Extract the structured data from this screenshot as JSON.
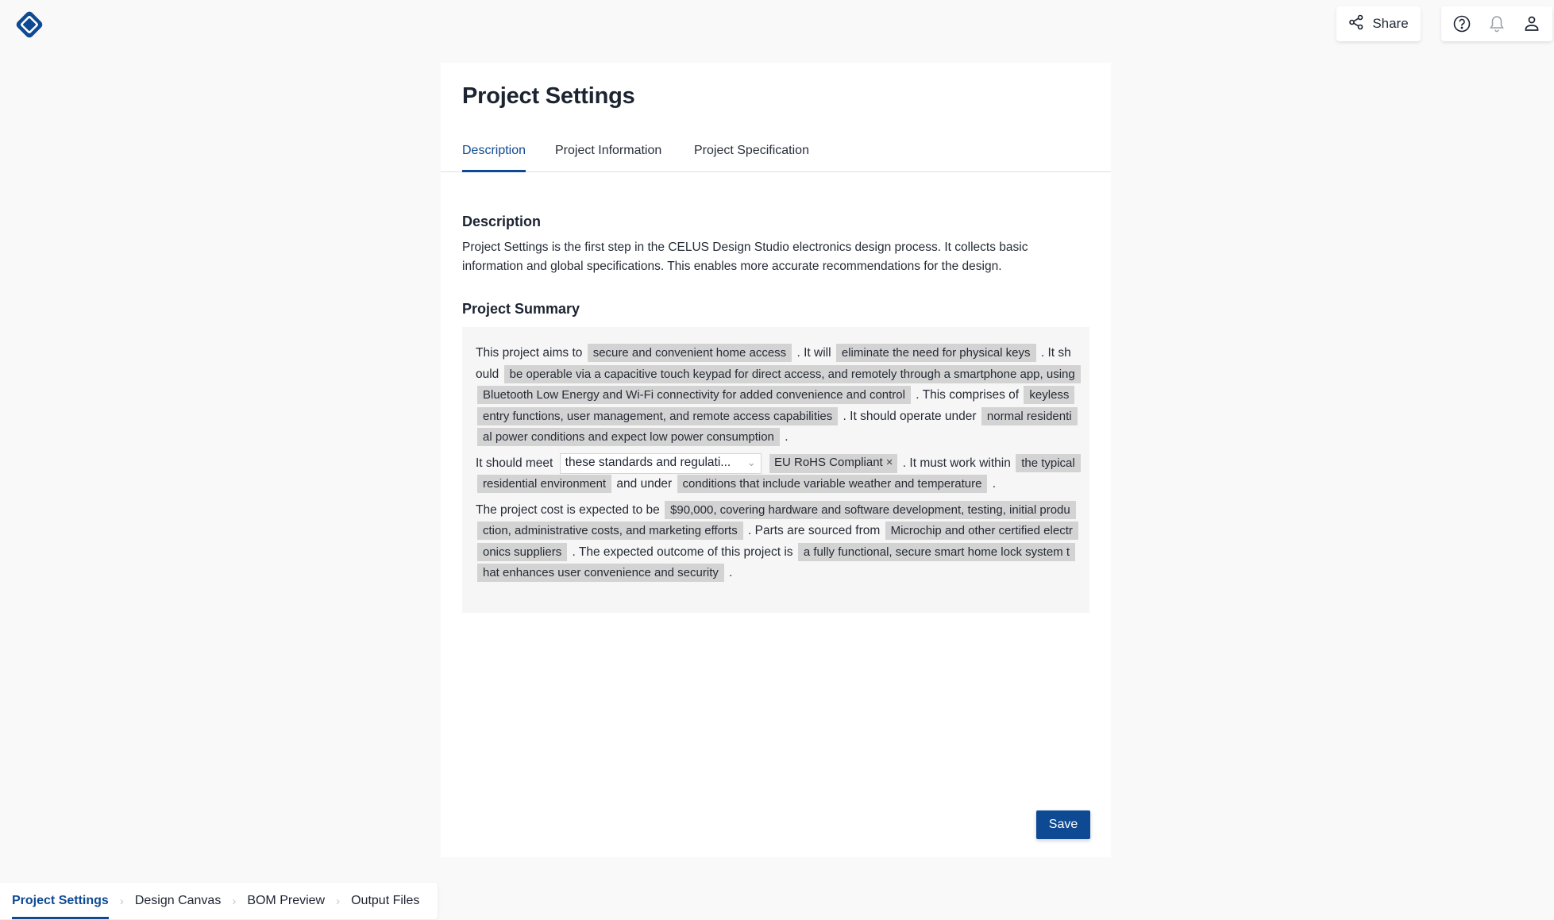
{
  "header": {
    "logo_icon": "celus-diamond-logo",
    "share_label": "Share",
    "icons": [
      "help-icon",
      "bell-icon",
      "user-icon"
    ]
  },
  "page": {
    "title": "Project Settings",
    "tabs": [
      {
        "label": "Description",
        "active": true
      },
      {
        "label": "Project Information",
        "active": false
      },
      {
        "label": "Project Specification",
        "active": false
      }
    ],
    "description": {
      "heading": "Description",
      "text": "Project Settings is the first step in the CELUS Design Studio electronics design process. It collects basic information and global specifications. This enables more accurate recommendations for the design."
    },
    "summary": {
      "heading": "Project Summary",
      "p1": {
        "t1": "This project aims to",
        "v1": "secure and convenient home access",
        "t2": ". It will",
        "v2": "eliminate the need for physical keys",
        "t3": ". It should",
        "v3": "be operable via a capacitive touch keypad for direct access, and remotely through a smartphone app, using Bluetooth Low Energy and Wi-Fi connectivity for added convenience and control",
        "t4": ". This comprises of",
        "v4": "keyless entry functions, user management, and remote access capabilities",
        "t5": ". It should operate under",
        "v5": "normal residential power conditions and expect low power consumption",
        "t6": "."
      },
      "p2": {
        "t1": "It should meet",
        "select_value": "these standards and regulati...",
        "tag": "EU RoHS Compliant",
        "t2": ". It must work within",
        "v1": "the typical residential environment",
        "t3": "and under",
        "v2": "conditions that include variable weather and temperature",
        "t4": "."
      },
      "p3": {
        "t1": "The project cost is expected to be",
        "v1": "$90,000, covering hardware and software development, testing, initial production, administrative costs, and marketing efforts",
        "t2": ". Parts are sourced from",
        "v2": "Microchip and other certified electronics suppliers",
        "t3": ". The expected outcome of this project is",
        "v3": "a fully functional, secure smart home lock system that enhances user convenience and security",
        "t4": "."
      }
    },
    "save_label": "Save"
  },
  "stepper": {
    "steps": [
      {
        "label": "Project Settings",
        "active": true
      },
      {
        "label": "Design Canvas",
        "active": false
      },
      {
        "label": "BOM Preview",
        "active": false
      },
      {
        "label": "Output Files",
        "active": false
      }
    ]
  },
  "colors": {
    "brand": "#0e4a94",
    "chip_bg": "#d3d3d3",
    "page_bg": "#f9f9f9"
  }
}
